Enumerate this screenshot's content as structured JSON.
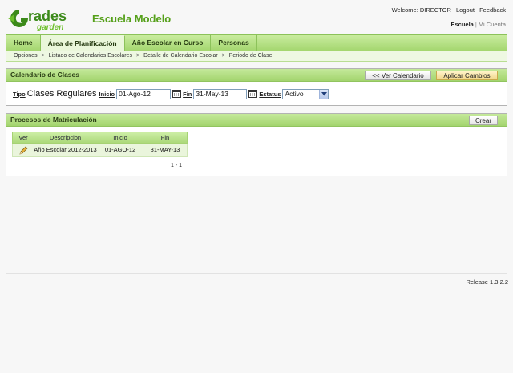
{
  "header": {
    "school_name": "Escuela Modelo",
    "welcome": "Welcome: DIRECTOR",
    "logout": "Logout",
    "feedback": "Feedback",
    "current_school": "Escuela",
    "separator": "|",
    "my_account": "Mi Cuenta",
    "logo_text_top": "rades",
    "logo_text_bottom": "garden",
    "logo_letter": "G"
  },
  "nav": {
    "tabs": [
      "Home",
      "Área de Planificación",
      "Año Escolar en Curso",
      "Personas"
    ],
    "active_index": 1
  },
  "breadcrumb": {
    "items": [
      "Opciones",
      "Listado de Calendarios Escolares",
      "Detalle de Calendario Escolar",
      "Periodo de Clase"
    ],
    "separator": ">"
  },
  "calendario": {
    "title": "Calendario de Clases",
    "ver_calendario": "<< Ver Calendario",
    "aplicar_cambios": "Aplicar Cambios",
    "tipo_label": "Tipo",
    "tipo_value": "Clases Regulares",
    "inicio_label": "Inicio",
    "inicio_value": "01-Ago-12",
    "fin_label": "Fin",
    "fin_value": "31-May-13",
    "estatus_label": "Estatus",
    "estatus_value": "Activo"
  },
  "procesos": {
    "title": "Procesos de Matriculación",
    "crear": "Crear",
    "columns": [
      "Ver",
      "Descripcion",
      "Inicio",
      "Fin"
    ],
    "rows": [
      {
        "descripcion": "Año Escolar 2012-2013",
        "inicio": "01-AGO-12",
        "fin": "31-MAY-13"
      }
    ],
    "pager": "1 - 1"
  },
  "footer": {
    "release": "Release 1.3.2.2"
  },
  "colors": {
    "brand_green": "#55a01a",
    "nav_green": "#a4d66f",
    "button_gold": "#f1d78b"
  }
}
